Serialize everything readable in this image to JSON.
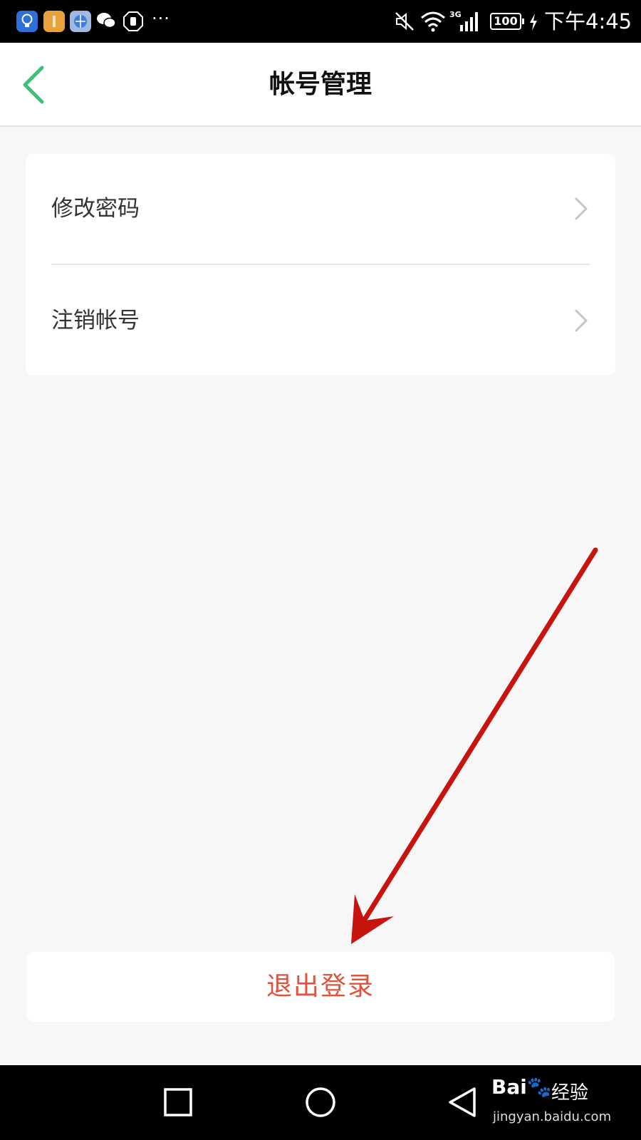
{
  "status_bar": {
    "network_type": "3G",
    "battery_level": "100",
    "time": "下午4:45",
    "more_indicator": "···",
    "icons": [
      "idea-app-icon",
      "notes-app-icon",
      "browser-app-icon",
      "wechat-icon",
      "hand-app-icon",
      "mute-icon",
      "wifi-icon",
      "signal-icon",
      "charging-icon"
    ]
  },
  "header": {
    "title": "帐号管理",
    "back_icon": "chevron-left-icon"
  },
  "settings": {
    "items": [
      {
        "label": "修改密码",
        "icon": "chevron-right-icon"
      },
      {
        "label": "注销帐号",
        "icon": "chevron-right-icon"
      }
    ]
  },
  "logout": {
    "label": "退出登录"
  },
  "system_nav": {
    "buttons": [
      "recent-apps-icon",
      "home-icon",
      "back-icon"
    ]
  },
  "watermark": {
    "logo": "Bai🐾",
    "text": "经验",
    "url": "jingyan.baidu.com"
  },
  "colors": {
    "accent_green": "#3cc07a",
    "logout_red": "#e0533a",
    "arrow_red": "#c8140e",
    "background": "#f7f7f7"
  }
}
